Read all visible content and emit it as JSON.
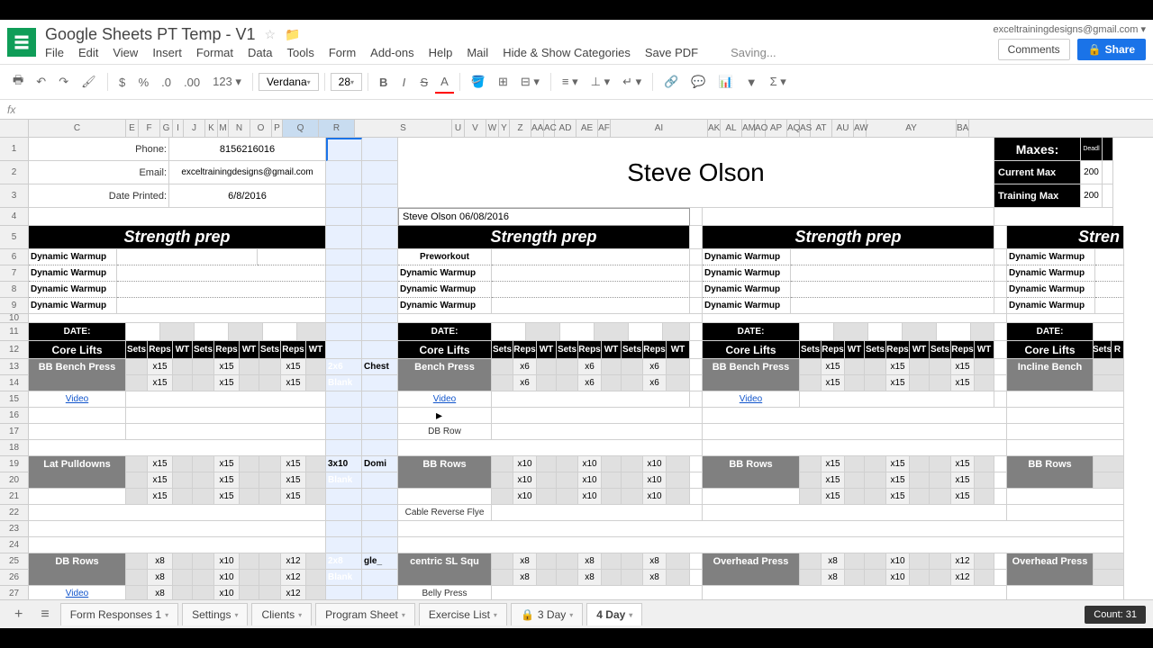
{
  "doc": {
    "title": "Google Sheets PT Temp - V1",
    "saving": "Saving..."
  },
  "user": {
    "email": "exceltrainingdesigns@gmail.com"
  },
  "buttons": {
    "comments": "Comments",
    "share": "Share"
  },
  "menu": [
    "File",
    "Edit",
    "View",
    "Insert",
    "Format",
    "Data",
    "Tools",
    "Form",
    "Add-ons",
    "Help",
    "Mail",
    "Hide & Show Categories",
    "Save PDF"
  ],
  "toolbar": {
    "font_name": "Verdana",
    "font_size": "28",
    "currency": "$",
    "percent": "%",
    "dec_dec": ".0",
    "dec_inc": ".00",
    "num_fmt": "123"
  },
  "info": {
    "phone_label": "Phone:",
    "phone_val": "8156216016",
    "email_label": "Email:",
    "email_val": "exceltrainingdesigns@gmail.com",
    "date_label": "Date Printed:",
    "date_val": "6/8/2016"
  },
  "client": {
    "name": "Steve Olson",
    "subtitle": "Steve Olson 06/08/2016"
  },
  "maxes": {
    "title": "Maxes:",
    "current": "Current Max",
    "training": "Training Max",
    "val1": "200",
    "val2": "200"
  },
  "headers": {
    "strength_prep": "Strength prep",
    "date": "DATE:",
    "core_lifts": "Core Lifts",
    "sets": "Sets",
    "reps": "Reps",
    "wt": "WT"
  },
  "warmup": {
    "dynamic": "Dynamic Warmup",
    "preworkout": "Preworkout"
  },
  "exercises": {
    "bb_bench": "BB Bench Press",
    "bench_press": "Bench Press",
    "incline_bench": "Incline Bench",
    "lat_pulldowns": "Lat Pulldowns",
    "bb_rows": "BB Rows",
    "db_rows": "DB Rows",
    "overhead_press": "Overhead Press",
    "eccentric_sl": "centric SL Squ",
    "video": "Video",
    "db_row_sub": "DB Row",
    "cable_reverse": "Cable Reverse Flye",
    "belly_press": "Belly Press"
  },
  "reps": {
    "x15": "x15",
    "x6": "x6",
    "x10": "x10",
    "x8": "x8",
    "x12": "x12"
  },
  "tags": {
    "t2x6": "2x6",
    "chest": "Chest",
    "blank": "Blank",
    "t3x10": "3x10",
    "domi": "Domi",
    "t2x8": "2x8",
    "gle": "gle_"
  },
  "columns": [
    "C",
    "E",
    "F",
    "G",
    "I",
    "J",
    "K",
    "M",
    "N",
    "O",
    "P",
    "Q",
    "R",
    "S",
    "U",
    "V",
    "W",
    "Y",
    "Z",
    "AA",
    "AC",
    "AD",
    "AE",
    "AF",
    "AI",
    "AK",
    "AL",
    "AM",
    "AO",
    "AP",
    "AQ",
    "AS",
    "AT",
    "AU",
    "AW",
    "AY",
    "BA"
  ],
  "rows": [
    "1",
    "2",
    "3",
    "4",
    "5",
    "6",
    "7",
    "8",
    "9",
    "10",
    "11",
    "12",
    "13",
    "14",
    "15",
    "16",
    "17",
    "18",
    "19",
    "20",
    "21",
    "22",
    "23",
    "24",
    "25",
    "26",
    "27"
  ],
  "tabs": {
    "items": [
      "Form Responses 1",
      "Settings",
      "Clients",
      "Program Sheet",
      "Exercise List"
    ],
    "locked": "3 Day",
    "active": "4 Day"
  },
  "status": {
    "count": "Count: 31"
  }
}
